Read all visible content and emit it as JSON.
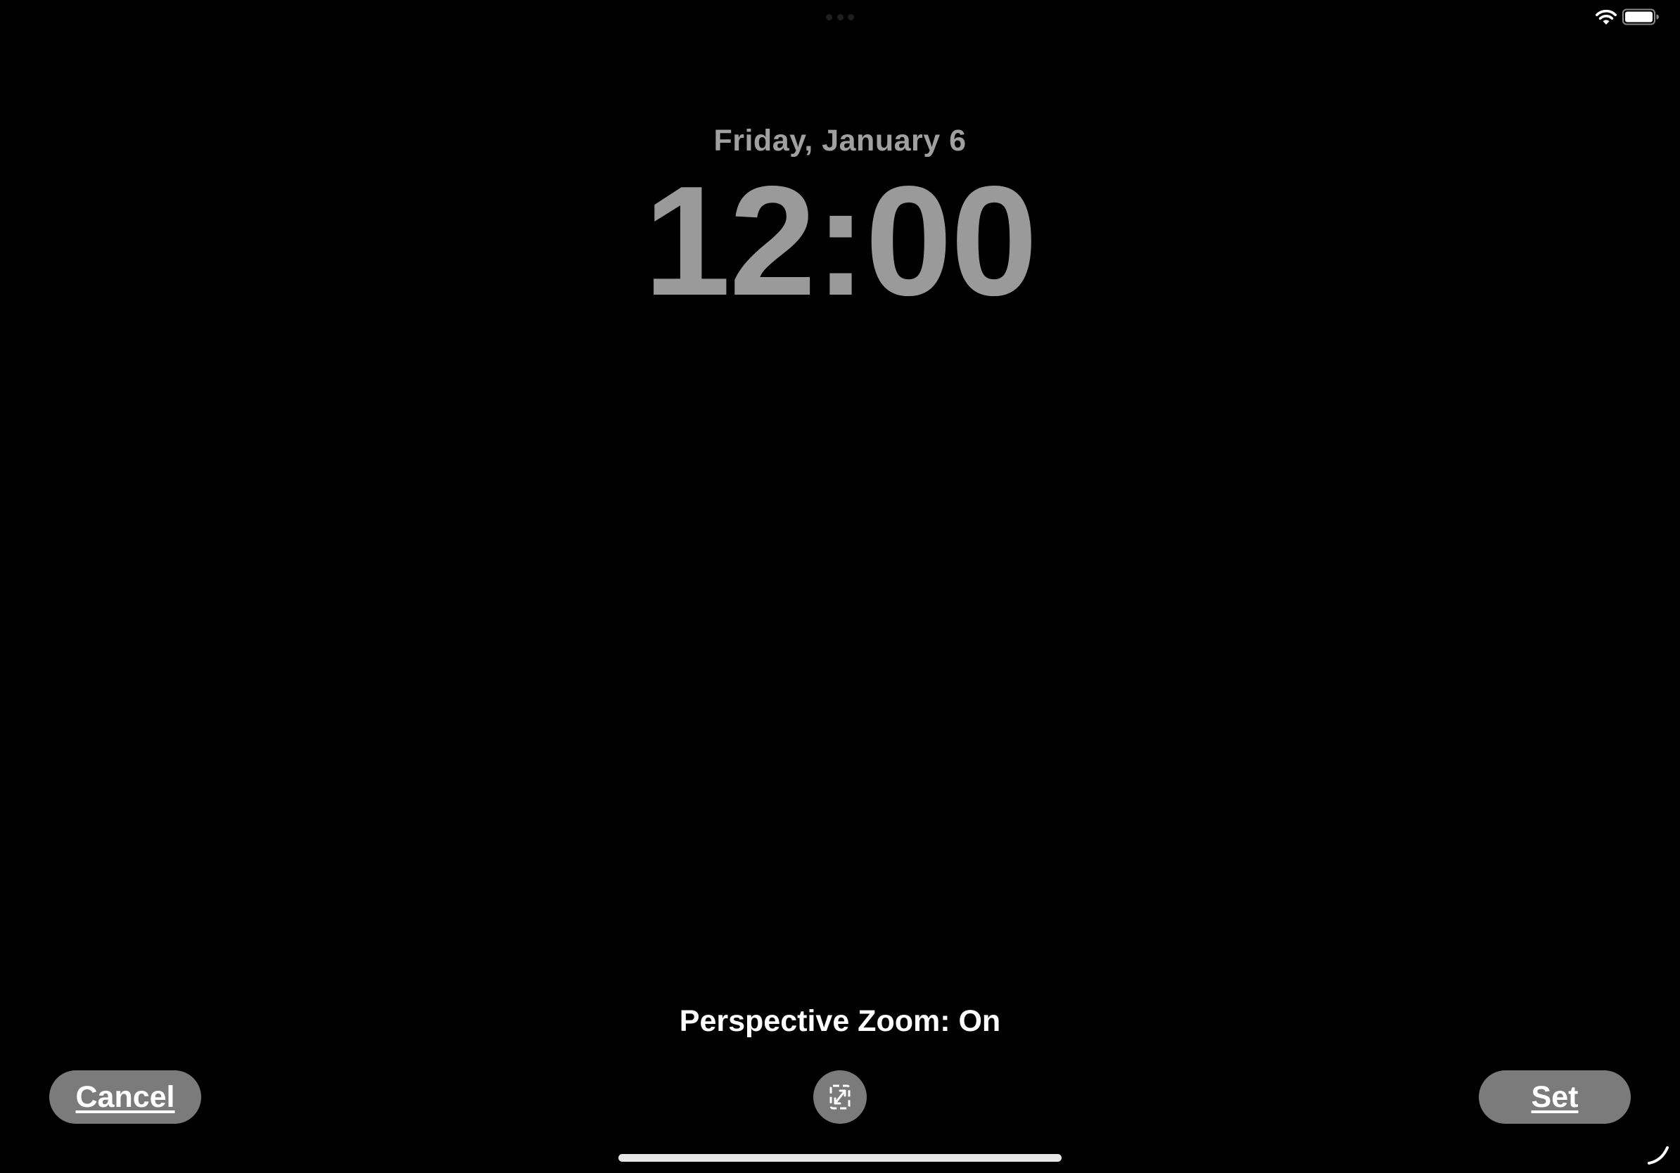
{
  "status_bar": {
    "wifi_icon": "wifi-icon",
    "battery_icon": "battery-icon",
    "multitask_icon": "ellipsis-icon"
  },
  "lock_screen": {
    "date": "Friday, January 6",
    "time": "12:00"
  },
  "wallpaper_editor": {
    "perspective_label": "Perspective Zoom: On",
    "cancel_label": "Cancel",
    "set_label": "Set",
    "perspective_toggle_icon": "perspective-zoom-icon"
  },
  "colors": {
    "background": "#000000",
    "clock_text": "#9a9a9a",
    "button_fill": "#7b7b7b",
    "button_text": "#ffffff"
  }
}
